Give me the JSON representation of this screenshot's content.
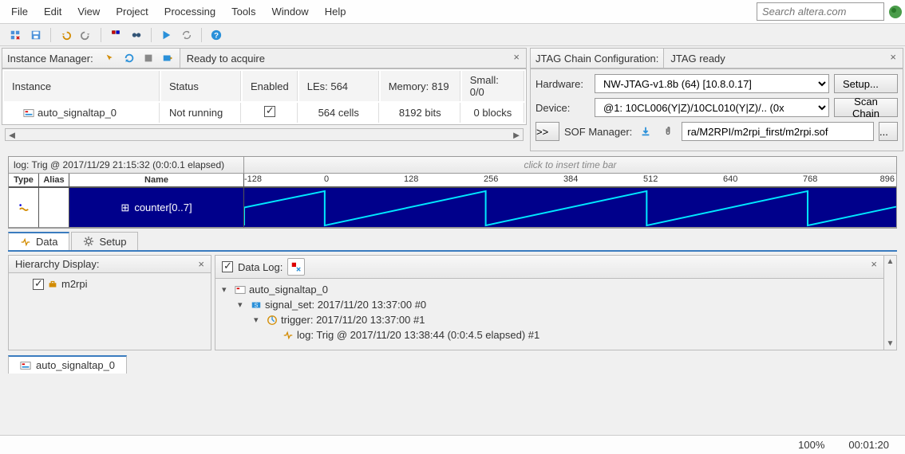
{
  "menu": [
    "File",
    "Edit",
    "View",
    "Project",
    "Processing",
    "Tools",
    "Window",
    "Help"
  ],
  "search_placeholder": "Search altera.com",
  "instance_panel": {
    "label": "Instance Manager:",
    "status": "Ready to acquire",
    "headers": [
      "Instance",
      "Status",
      "Enabled",
      "LEs: 564",
      "Memory: 819",
      "Small: 0/0"
    ],
    "row": {
      "instance": "auto_signaltap_0",
      "status": "Not running",
      "enabled": true,
      "les": "564 cells",
      "memory": "8192 bits",
      "small": "0 blocks"
    }
  },
  "jtag_panel": {
    "label": "JTAG Chain Configuration:",
    "status": "JTAG ready",
    "hardware_label": "Hardware:",
    "hardware_value": "NW-JTAG-v1.8b (64) [10.8.0.17]",
    "setup_btn": "Setup...",
    "device_label": "Device:",
    "device_value": "@1: 10CL006(Y|Z)/10CL010(Y|Z)/.. (0x",
    "scanchain_btn": "Scan Chain",
    "sof_label": "SOF Manager:",
    "sof_path": "ra/M2RPI/m2rpi_first/m2rpi.sof"
  },
  "waveform": {
    "log_title": "log: Trig @ 2017/11/29 21:15:32 (0:0:0.1 elapsed)",
    "right_title": "click to insert time bar",
    "col_headers": [
      "Type",
      "Alias",
      "Name"
    ],
    "signal_name": "counter[0..7]",
    "ticks": [
      "-128",
      "0",
      "128",
      "256",
      "384",
      "512",
      "640",
      "768",
      "896"
    ]
  },
  "tabs": {
    "data": "Data",
    "setup": "Setup"
  },
  "hierarchy": {
    "title": "Hierarchy Display:",
    "item": "m2rpi"
  },
  "datalog": {
    "title": "Data Log:",
    "items": [
      "auto_signaltap_0",
      "signal_set: 2017/11/20 13:37:00  #0",
      "trigger: 2017/11/20 13:37:00  #1",
      "log: Trig @ 2017/11/20 13:38:44 (0:0:4.5 elapsed) #1"
    ]
  },
  "bottom_tab": "auto_signaltap_0",
  "status": {
    "zoom": "100%",
    "time": "00:01:20"
  }
}
